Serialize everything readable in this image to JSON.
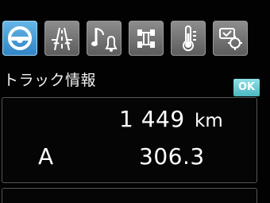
{
  "icons": [
    {
      "name": "steering-wheel-icon",
      "active": true
    },
    {
      "name": "road-icon",
      "active": false
    },
    {
      "name": "music-bell-icon",
      "active": false
    },
    {
      "name": "truck-chassis-icon",
      "active": false
    },
    {
      "name": "temperature-icon",
      "active": false
    },
    {
      "name": "settings-icon",
      "active": false
    }
  ],
  "header": {
    "title": "トラック情報",
    "ok_label": "OK"
  },
  "trip_info": {
    "odometer_value": "1 449",
    "odometer_unit": "km",
    "trip_label": "A",
    "trip_value": "306.3"
  },
  "colors": {
    "active_icon": "#3f98d6",
    "ok_badge": "#6ccfd6",
    "panel_border": "#555555"
  }
}
